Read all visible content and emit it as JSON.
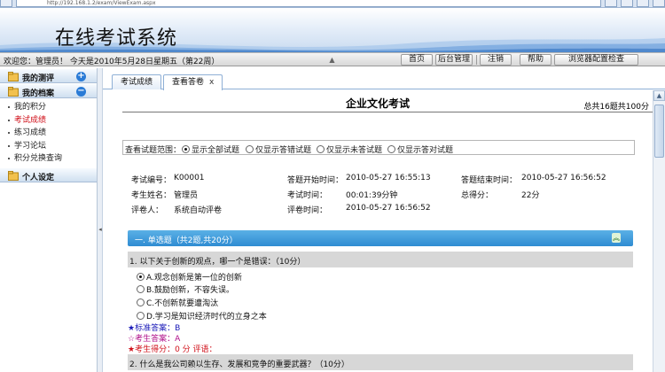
{
  "browser": {
    "address": "http://192.168.1.2/exam/ViewExam.aspx"
  },
  "banner": {
    "title": "在线考试系统"
  },
  "navbar": {
    "welcome": "欢迎您：管理员！ 今天是2010年5月28日星期五（第22周）",
    "buttons": [
      "首页",
      "后台管理",
      "注销",
      "帮助",
      "浏览器配置检查"
    ]
  },
  "sidebar": {
    "groups": [
      {
        "label": "我的测评",
        "toggle": "+"
      },
      {
        "label": "我的档案",
        "toggle": "−"
      },
      {
        "label": "个人设定",
        "toggle": ""
      }
    ],
    "items": [
      "我的积分",
      "考试成绩",
      "练习成绩",
      "学习论坛",
      "积分兑换查询"
    ],
    "active_item": "考试成绩"
  },
  "tabs": [
    {
      "label": "考试成绩"
    },
    {
      "label": "查看答卷",
      "close": "x"
    }
  ],
  "exam": {
    "title": "企业文化考试",
    "summary": "总共16题共100分",
    "filter_label": "查看试题范围：",
    "filter_options": [
      "显示全部试题",
      "仅显示答错试题",
      "仅显示未答试题",
      "仅显示答对试题"
    ],
    "filter_selected": "显示全部试题",
    "info": {
      "exam_no_label": "考试编号：",
      "exam_no": "K00001",
      "start_label": "答题开始时间：",
      "start": "2010-05-27 16:55:13",
      "end_label": "答题结束时间：",
      "end": "2010-05-27 16:56:52",
      "name_label": "考生姓名：",
      "name": "管理员",
      "duration_label": "考试时间：",
      "duration": "00:01:39分钟",
      "score_label": "总得分：",
      "score": "22分",
      "grader_label": "评卷人：",
      "grader": "系统自动评卷",
      "grade_time_label": "评卷时间：",
      "grade_time": "2010-05-27 16:56:52"
    },
    "section_title": "一. 单选题（共2题,共20分）",
    "questions": [
      {
        "text": "1. 以下关于创新的观点，哪一个是错误：（10分）",
        "options": [
          "A.观念创新是第一位的创新",
          "B.鼓励创新，不容失误。",
          "C.不创新就要遭淘汰",
          "D.学习是知识经济时代的立身之本"
        ],
        "selected": "A",
        "standard_answer": "★标准答案：B",
        "student_answer": "☆考生答案：A",
        "student_score": "★考生得分：0 分  评语："
      },
      {
        "text": "2. 什么是我公司赖以生存、发展和竞争的重要武器？（10分）"
      }
    ]
  },
  "colors": {
    "section_bar": "#2f8cd2",
    "active_item": "#d0101a",
    "standard_answer": "#1a1ab8",
    "student_answer": "#b0108a",
    "student_score": "#d0101a"
  }
}
